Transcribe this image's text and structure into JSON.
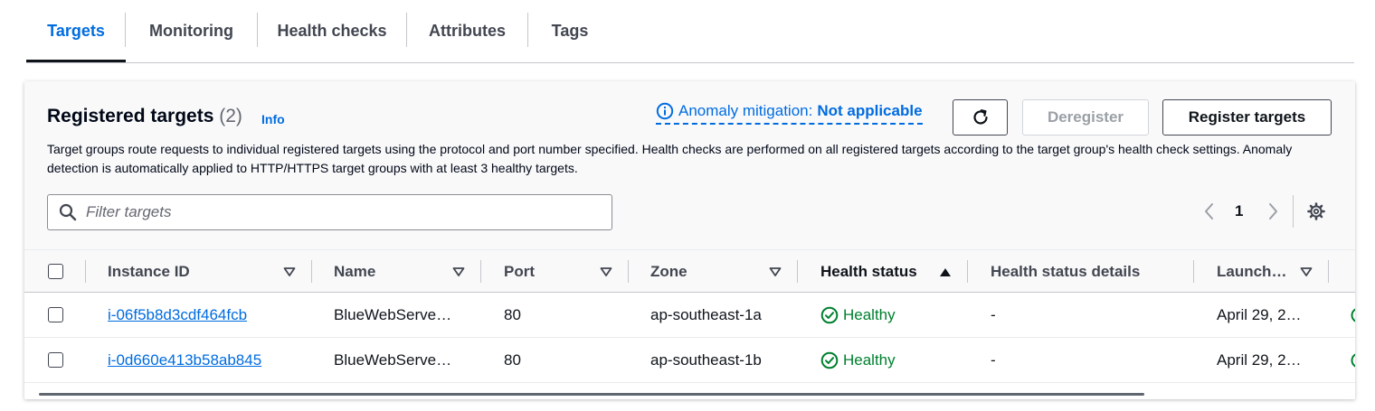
{
  "tabs": [
    "Targets",
    "Monitoring",
    "Health checks",
    "Attributes",
    "Tags"
  ],
  "panel": {
    "title": "Registered targets",
    "count": "(2)",
    "info_link": "Info",
    "description": "Target groups route requests to individual registered targets using the protocol and port number specified. Health checks are performed on all registered targets according to the target group's health check settings. Anomaly detection is automatically applied to HTTP/HTTPS target groups with at least 3 healthy targets.",
    "anomaly_label": "Anomaly mitigation:",
    "anomaly_value": "Not applicable",
    "deregister_label": "Deregister",
    "register_label": "Register targets",
    "filter_placeholder": "Filter targets",
    "page_number": "1"
  },
  "table": {
    "columns": {
      "instance_id": "Instance ID",
      "name": "Name",
      "port": "Port",
      "zone": "Zone",
      "health_status": "Health status",
      "health_details": "Health status details",
      "launch": "Launch…"
    },
    "rows": [
      {
        "instance_id": "i-06f5b8d3cdf464fcb",
        "name": "BlueWebServe…",
        "port": "80",
        "zone": "ap-southeast-1a",
        "health": "Healthy",
        "details": "-",
        "launch": "April 29, 2…"
      },
      {
        "instance_id": "i-0d660e413b58ab845",
        "name": "BlueWebServe…",
        "port": "80",
        "zone": "ap-southeast-1b",
        "health": "Healthy",
        "details": "-",
        "launch": "April 29, 2…"
      }
    ]
  },
  "colors": {
    "link": "#006ce0",
    "healthy": "#00802f",
    "text": "#0f141a",
    "disabled": "#9ba0a6"
  },
  "icons": [
    "refresh-icon",
    "info-circle-icon",
    "search-icon",
    "chevron-left-icon",
    "chevron-right-icon",
    "settings-gear-icon",
    "sort-caret-down-icon",
    "sort-caret-up-icon",
    "status-check-circle-icon"
  ]
}
